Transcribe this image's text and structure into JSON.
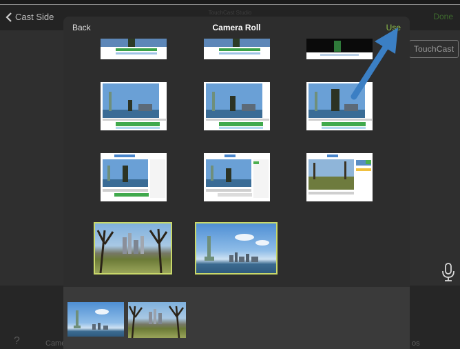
{
  "background": {
    "back_label": "Cast Side",
    "title": "TouchCast Studio",
    "done_label": "Done",
    "logo_text": "TouchCast",
    "bottom_left_help": "?",
    "bottom_left_label": "Came",
    "bottom_right_label": "os"
  },
  "modal": {
    "back_label": "Back",
    "title": "Camera Roll",
    "use_label": "Use"
  },
  "colors": {
    "accent_green": "#8fbf4a",
    "arrow_blue": "#3b7fc4",
    "selection": "#c9d86a"
  },
  "icons": {
    "back_chevron": "chevron-left-icon",
    "microphone": "microphone-icon",
    "help": "help-icon"
  }
}
